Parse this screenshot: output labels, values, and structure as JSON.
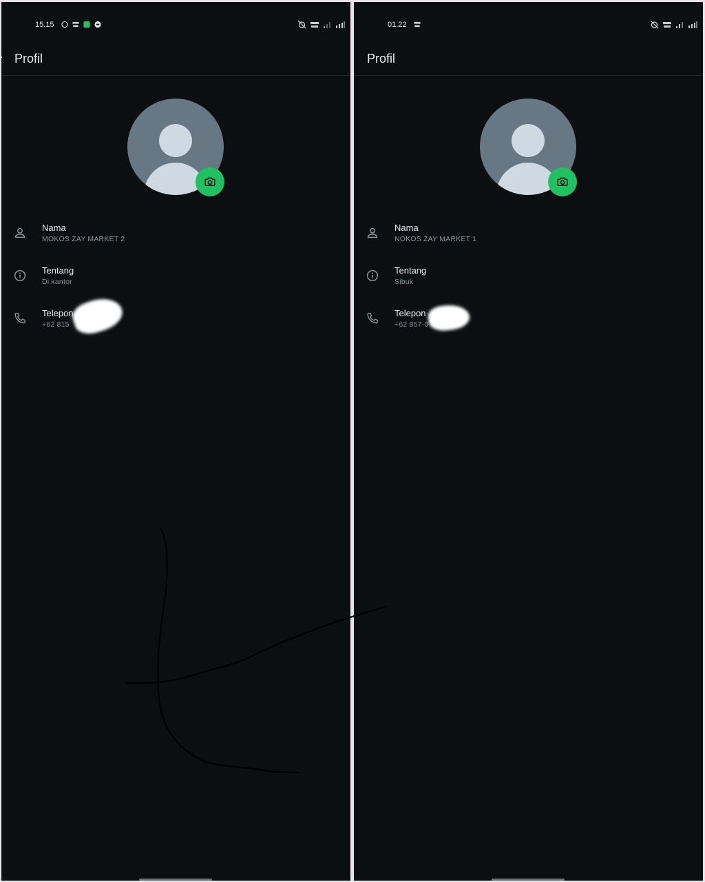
{
  "left": {
    "status": {
      "time": "15.15"
    },
    "title": "Profil",
    "rows": [
      {
        "label": "Nama",
        "value": "MOKOS ZAY MARKET 2",
        "icon": "person-icon"
      },
      {
        "label": "Tentang",
        "value": "Di kantor",
        "icon": "info-icon"
      },
      {
        "label": "Telepon",
        "value": "+62 815",
        "icon": "phone-icon"
      }
    ]
  },
  "right": {
    "status": {
      "time": "01.22"
    },
    "title": "Profil",
    "rows": [
      {
        "label": "Nama",
        "value": "NOKOS ZAY MARKET 1",
        "icon": "person-icon"
      },
      {
        "label": "Tentang",
        "value": "Sibuk",
        "icon": "info-icon"
      },
      {
        "label": "Telepon",
        "value": "+62 857-0",
        "icon": "phone-icon"
      }
    ]
  },
  "colors": {
    "background": "#0b0f12",
    "accent": "#21c063",
    "primary_text": "#e9edef",
    "secondary_text": "#8696a0",
    "avatar_bg": "#677784"
  }
}
